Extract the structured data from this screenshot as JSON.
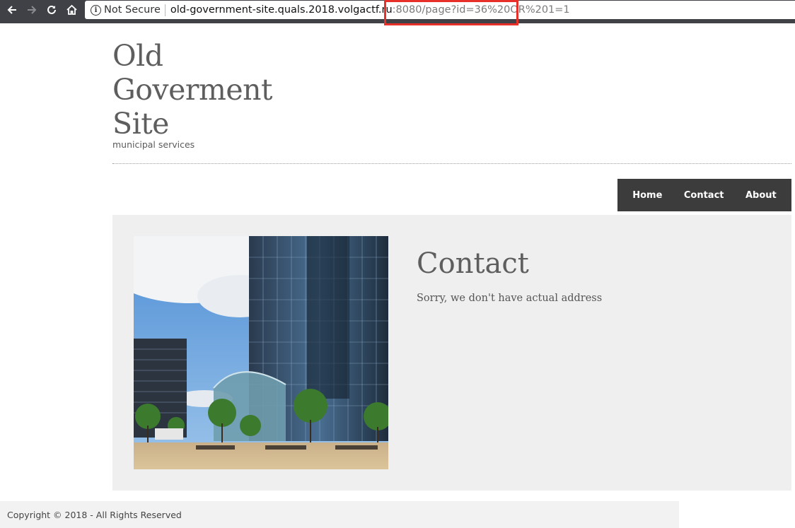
{
  "browser": {
    "security_label": "Not Secure",
    "url_host": "old-government-site.quals.2018.volgactf.ru",
    "url_port": ":8080",
    "url_path": "/page?id=36%20OR%201=1",
    "icons": {
      "back": "arrow-left-icon",
      "forward": "arrow-right-icon",
      "reload": "reload-icon",
      "home": "home-icon",
      "info": "info-icon"
    },
    "highlight_color": "#e8302b"
  },
  "site": {
    "title_lines": [
      "Old",
      "Goverment",
      "Site"
    ],
    "tagline": "municipal services"
  },
  "nav": {
    "items": [
      {
        "label": "Home"
      },
      {
        "label": "Contact"
      },
      {
        "label": "About"
      }
    ],
    "background": "#3c3c3c"
  },
  "content": {
    "heading": "Contact",
    "text": "Sorry, we don't have actual address",
    "image": "city-buildings-photo"
  },
  "footer": {
    "text": "Copyright © 2018 - All Rights Reserved"
  }
}
